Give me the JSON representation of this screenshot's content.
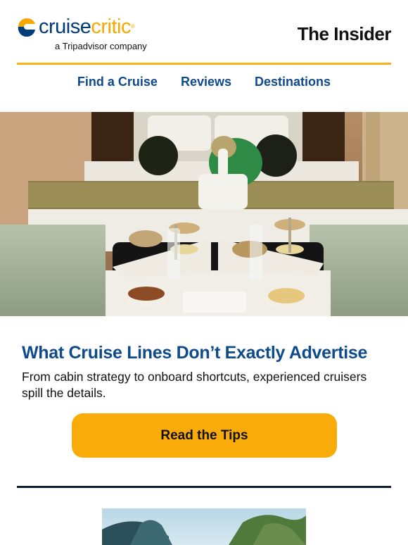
{
  "header": {
    "logo_word_1": "cruise",
    "logo_word_2": "critic",
    "logo_tm": "®",
    "logo_tagline": "a Tripadvisor company",
    "title": "The Insider"
  },
  "nav": {
    "items": [
      {
        "label": "Find a Cruise"
      },
      {
        "label": "Reviews"
      },
      {
        "label": "Destinations"
      }
    ]
  },
  "article": {
    "headline": "What Cruise Lines Don’t Exactly Advertise",
    "subtext": "From cabin strategy to onboard shortcuts, experienced cruisers spill the details.",
    "cta_label": "Read the Tips"
  },
  "colors": {
    "brand_blue": "#0f4a8a",
    "brand_yellow": "#f9ab0a",
    "rule_yellow": "#f9b21b",
    "rule_dark": "#0e1f33"
  }
}
